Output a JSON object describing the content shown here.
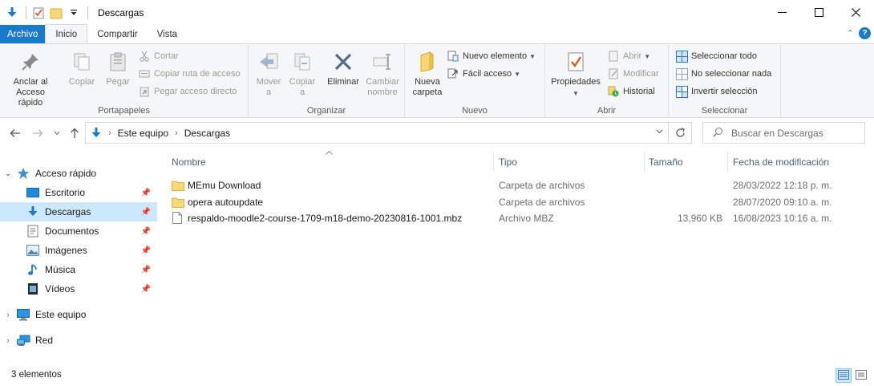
{
  "window": {
    "title": "Descargas",
    "controls": [
      "minimize",
      "maximize",
      "close"
    ]
  },
  "quick_access_toolbar": [
    "properties-icon",
    "new-folder-icon",
    "customize-dropdown-icon"
  ],
  "ribbon": {
    "tabs": [
      {
        "label": "Archivo"
      },
      {
        "label": "Inicio"
      },
      {
        "label": "Compartir"
      },
      {
        "label": "Vista"
      }
    ],
    "groups": {
      "portapapeles": {
        "label": "Portapapeles",
        "anclar": "Anclar al\nAcceso rápido",
        "copiar": "Copiar",
        "pegar": "Pegar",
        "cortar": "Cortar",
        "copiar_ruta": "Copiar ruta de acceso",
        "pegar_acceso": "Pegar acceso directo"
      },
      "organizar": {
        "label": "Organizar",
        "mover": "Mover\na",
        "copiar_a": "Copiar\na",
        "eliminar": "Eliminar",
        "cambiar_nombre": "Cambiar\nnombre"
      },
      "nuevo": {
        "label": "Nuevo",
        "nueva_carpeta": "Nueva\ncarpeta",
        "nuevo_elemento": "Nuevo elemento",
        "facil_acceso": "Fácil acceso"
      },
      "abrir": {
        "label": "Abrir",
        "propiedades": "Propiedades",
        "abrir": "Abrir",
        "modificar": "Modificar",
        "historial": "Historial"
      },
      "seleccionar": {
        "label": "Seleccionar",
        "todo": "Seleccionar todo",
        "nada": "No seleccionar nada",
        "invertir": "Invertir selección"
      }
    }
  },
  "address_bar": {
    "crumbs": [
      "Este equipo",
      "Descargas"
    ],
    "search_placeholder": "Buscar en Descargas"
  },
  "nav_pane": {
    "items": [
      {
        "label": "Acceso rápido",
        "icon": "star-icon"
      },
      {
        "label": "Escritorio",
        "icon": "desktop-icon"
      },
      {
        "label": "Descargas",
        "icon": "download-icon"
      },
      {
        "label": "Documentos",
        "icon": "document-icon"
      },
      {
        "label": "Imágenes",
        "icon": "pictures-icon"
      },
      {
        "label": "Música",
        "icon": "music-icon"
      },
      {
        "label": "Vídeos",
        "icon": "videos-icon"
      },
      {
        "label": "Este equipo",
        "icon": "computer-icon"
      },
      {
        "label": "Red",
        "icon": "network-icon"
      }
    ]
  },
  "file_list": {
    "columns": [
      "Nombre",
      "Tipo",
      "Tamaño",
      "Fecha de modificación"
    ],
    "rows": [
      {
        "name": "MEmu Download",
        "type": "Carpeta de archivos",
        "size": "",
        "date": "28/03/2022 12:18 p. m.",
        "icon": "folder-icon"
      },
      {
        "name": "opera autoupdate",
        "type": "Carpeta de archivos",
        "size": "",
        "date": "28/07/2020 09:10 a. m.",
        "icon": "folder-icon"
      },
      {
        "name": "respaldo-moodle2-course-1709-m18-demo-20230816-1001.mbz",
        "type": "Archivo MBZ",
        "size": "13,960 KB",
        "date": "16/08/2023 10:16 a. m.",
        "icon": "file-icon"
      }
    ]
  },
  "status_bar": {
    "item_count": "3 elementos"
  },
  "colors": {
    "accent": "#1979ca",
    "selection": "#cce8ff",
    "folder": "#f8d775",
    "column_header": "#4c607a"
  }
}
